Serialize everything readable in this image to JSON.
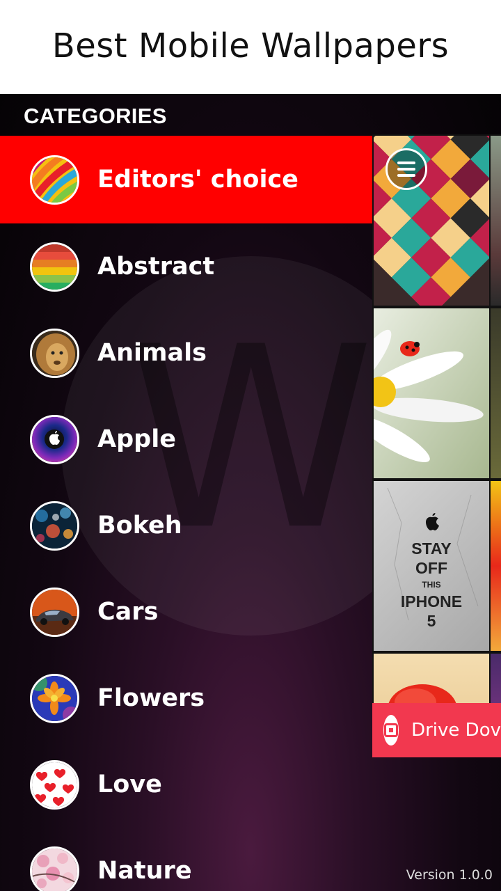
{
  "header": {
    "title": "Best Mobile Wallpapers"
  },
  "drawer": {
    "heading": "CATEGORIES",
    "watermark": "W",
    "items": [
      {
        "label": "Editors' choice",
        "icon": "editors-choice-thumb",
        "active": true
      },
      {
        "label": "Abstract",
        "icon": "abstract-thumb",
        "active": false
      },
      {
        "label": "Animals",
        "icon": "animals-thumb",
        "active": false
      },
      {
        "label": "Apple",
        "icon": "apple-thumb",
        "active": false
      },
      {
        "label": "Bokeh",
        "icon": "bokeh-thumb",
        "active": false
      },
      {
        "label": "Cars",
        "icon": "cars-thumb",
        "active": false
      },
      {
        "label": "Flowers",
        "icon": "flowers-thumb",
        "active": false
      },
      {
        "label": "Love",
        "icon": "love-thumb",
        "active": false
      },
      {
        "label": "Nature",
        "icon": "nature-thumb",
        "active": false
      }
    ],
    "version": "Version 1.0.0"
  },
  "content": {
    "wallpaper_text": {
      "line1": "STAY",
      "line2": "OFF",
      "line3": "THIS",
      "line4": "IPHONE",
      "line5": "5"
    },
    "banner": {
      "label": "Drive Dov"
    }
  },
  "colors": {
    "active": "#ff0000",
    "banner": "#f2384f",
    "header_bg": "#ffffff"
  }
}
